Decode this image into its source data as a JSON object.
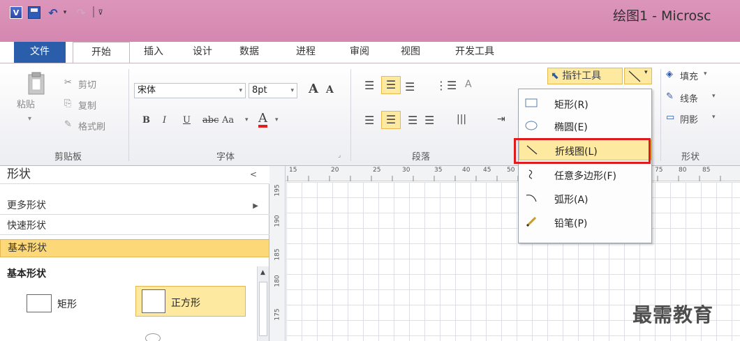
{
  "titlebar": {
    "app_icon_letter": "V",
    "title": "绘图1 - Microsc"
  },
  "tabs": [
    {
      "label": "文件"
    },
    {
      "label": "开始"
    },
    {
      "label": "插入"
    },
    {
      "label": "设计"
    },
    {
      "label": "数据"
    },
    {
      "label": "进程"
    },
    {
      "label": "审阅"
    },
    {
      "label": "视图"
    },
    {
      "label": "开发工具"
    }
  ],
  "clipboard": {
    "paste": "粘贴",
    "cut": "剪切",
    "copy": "复制",
    "format_painter": "格式刷",
    "group_label": "剪贴板"
  },
  "font": {
    "font_name": "宋体",
    "font_size": "8pt",
    "grow": "A",
    "shrink": "A",
    "bold": "B",
    "italic": "I",
    "underline": "U",
    "strike": "abc",
    "case": "Aa",
    "color_a": "A",
    "group_label": "字体"
  },
  "paragraph": {
    "group_label": "段落"
  },
  "tools": {
    "pointer_tool": "指针工具"
  },
  "shape_group": {
    "fill": "填充",
    "line": "线条",
    "shadow": "阴影",
    "group_label": "形状"
  },
  "dropdown": {
    "items": [
      {
        "label": "矩形(R)"
      },
      {
        "label": "椭圆(E)"
      },
      {
        "label": "折线图(L)"
      },
      {
        "label": "任意多边形(F)"
      },
      {
        "label": "弧形(A)"
      },
      {
        "label": "铅笔(P)"
      }
    ],
    "selected": "折线图(L)"
  },
  "shapes_panel": {
    "title": "形状",
    "collapse_glyph": "<",
    "more_shapes": "更多形状",
    "quick_shapes": "快速形状",
    "basic_shapes": "基本形状",
    "section_title": "基本形状",
    "shape_rect": "矩形",
    "shape_square": "正方形"
  },
  "ruler": {
    "h_ticks": [
      "15",
      "20",
      "25",
      "30",
      "35",
      "40",
      "45",
      "50",
      "75",
      "80",
      "85"
    ],
    "v_ticks": [
      "195",
      "190",
      "185",
      "180",
      "175"
    ]
  },
  "watermark": "最需教育",
  "colors": {
    "titlebar": "#d98fb5",
    "file_tab": "#2a5eab",
    "highlight": "#fde9a0",
    "annotation_box": "#e01b1b"
  }
}
